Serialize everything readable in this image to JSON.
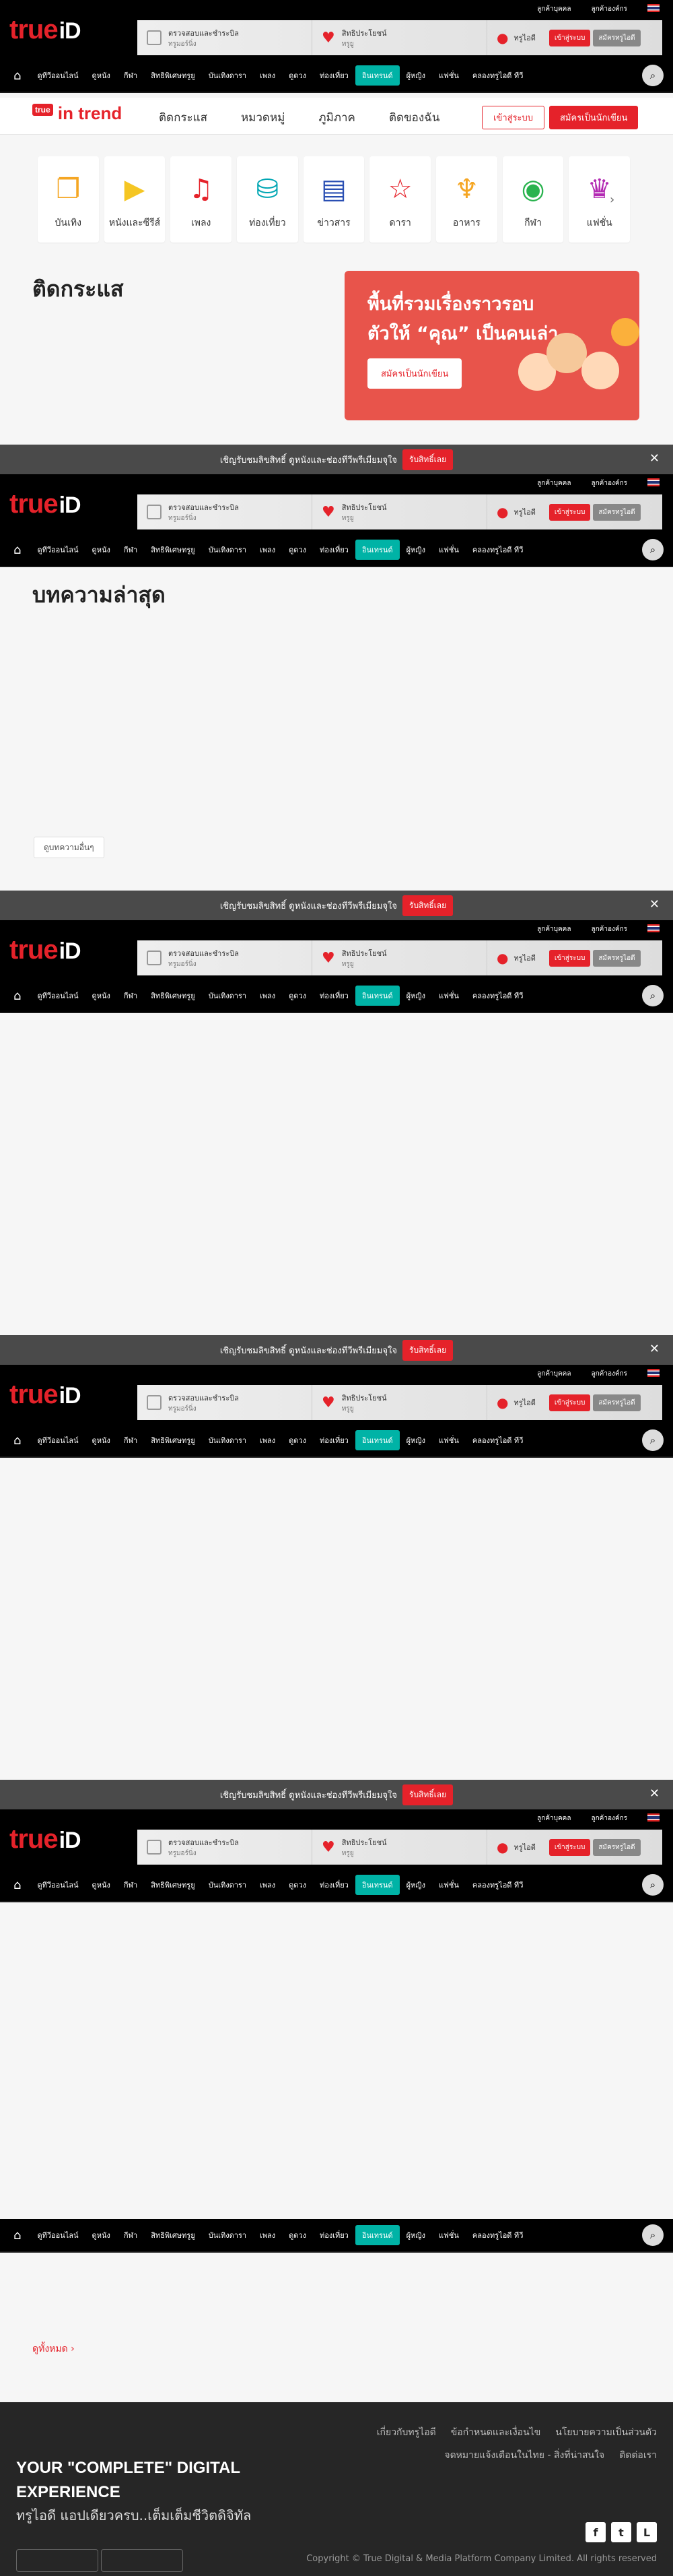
{
  "promo": {
    "text": "เชิญรับชมลิขสิทธิ์ ดูหนังและช่องทีวีพรีเมียมจุใจ",
    "cta": "รับสิทธิ์เลย",
    "close": "✕"
  },
  "header": {
    "logo_true": "true",
    "logo_id": "iD",
    "top_links": [
      "ลูกค้าบุคคล",
      "ลูกค้าองค์กร"
    ],
    "box1_title": "ตรวจสอบและชำระบิล",
    "box1_sub": "ทรูมอร์นิ่ง",
    "box2_title": "สิทธิประโยชน์",
    "box2_sub": "ทรูยู",
    "user_label": "ทรูไอดี",
    "login": "เข้าสู่ระบบ",
    "register": "สมัครทรูไอดี"
  },
  "nav": {
    "items": [
      "ดูทีวีออนไลน์",
      "ดูหนัง",
      "กีฬา",
      "สิทธิพิเศษทรูยู",
      "บันเทิงดารา",
      "เพลง",
      "ดูดวง",
      "ท่องเที่ยว",
      "อินเทรนด์",
      "ผู้หญิง",
      "แฟชั่น",
      "คลองทรูไอดี ทีวี"
    ]
  },
  "intrend": {
    "logo": "in trend",
    "logo_badge": "true",
    "menu": [
      "ติดกระแส",
      "หมวดหมู่",
      "ภูมิภาค",
      "ติดของฉัน"
    ],
    "login": "เข้าสู่ระบบ",
    "register": "สมัครเป็นนักเขียน"
  },
  "categories": [
    {
      "label": "บันเทิง",
      "icon": "❐",
      "color": "#f5a623"
    },
    {
      "label": "หนังและซีรีส์",
      "icon": "▶",
      "color": "#f5c623"
    },
    {
      "label": "เพลง",
      "icon": "♫",
      "color": "#e5222a"
    },
    {
      "label": "ท่องเที่ยว",
      "icon": "⛁",
      "color": "#00a6b3"
    },
    {
      "label": "ข่าวสาร",
      "icon": "▤",
      "color": "#2a4fb3"
    },
    {
      "label": "ดารา",
      "icon": "☆",
      "color": "#e5222a"
    },
    {
      "label": "อาหาร",
      "icon": "♆",
      "color": "#f5a623"
    },
    {
      "label": "กีฬา",
      "icon": "◉",
      "color": "#2ab34f"
    },
    {
      "label": "แฟชั่น",
      "icon": "♛",
      "color": "#b32ab3"
    }
  ],
  "trending_title": "ติดกระแส",
  "banner": {
    "line1": "พื้นที่รวมเรื่องราวรอบ",
    "line2": "ตัวให้ “คุณ” เป็นคนเล่า",
    "cta": "สมัครเป็นนักเขียน"
  },
  "latest_title": "บทความล่าสุด",
  "more_articles": "ดูบทความอื่นๆ",
  "see_all": "ดูทั้งหมด ›",
  "footer": {
    "links": [
      "เกี่ยวกับทรูไอดี",
      "ข้อกำหนดและเงื่อนไข",
      "นโยบายความเป็นส่วนตัว",
      "จดหมายแจ้งเตือนในไทย - สิ่งที่น่าสนใจ",
      "ติดต่อเรา"
    ],
    "title_line1": "YOUR \"COMPLETE\" DIGITAL",
    "title_line2": "EXPERIENCE",
    "subtitle": "ทรูไอดี แอปเดียวครบ..เต็มเต็มชีวิตดิจิทัล",
    "copyright": "Copyright © True Digital & Media Platform Company Limited. All rights reserved"
  },
  "colors": {
    "brand_red": "#e5222a",
    "active_teal": "#00b3a6",
    "header_black": "#000000",
    "footer_dark": "#262626"
  },
  "icons": {
    "home": "home-icon",
    "search": "search-icon",
    "close": "close-icon",
    "heart": "heart-icon",
    "user": "user-icon"
  }
}
